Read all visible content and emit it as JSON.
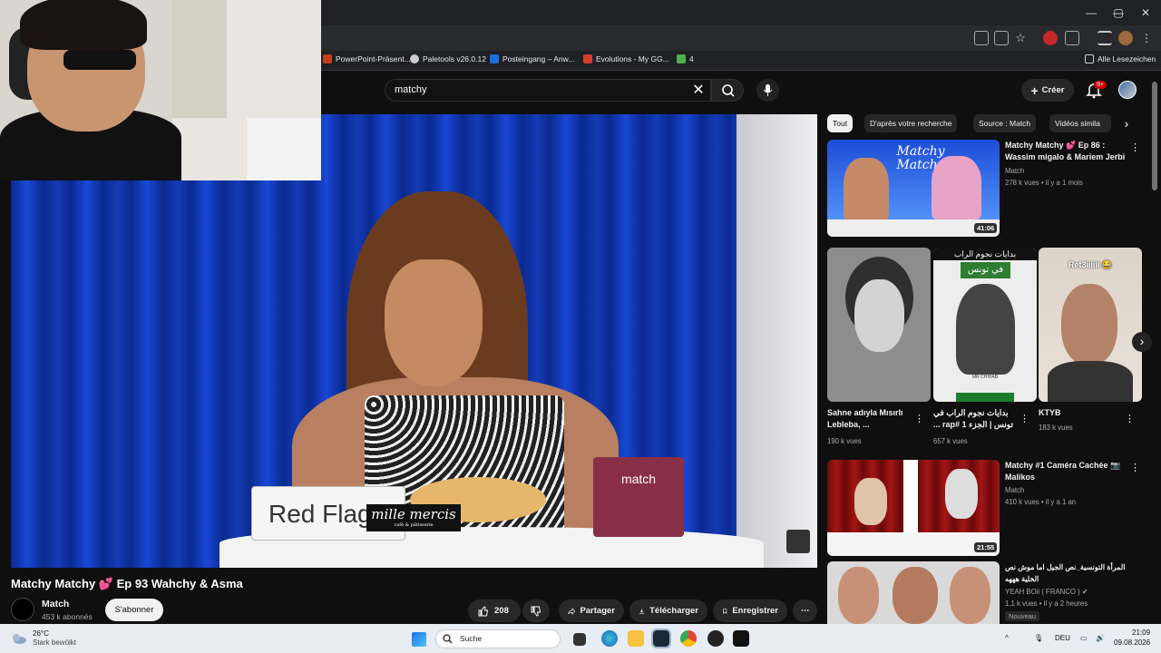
{
  "browser": {
    "window_controls": [
      "—",
      "▢",
      "✕"
    ],
    "bookmarks": [
      {
        "label": "PowerPoint-Präsent...",
        "color": "#c43e1c"
      },
      {
        "label": "Paletools v26.0.12",
        "color": "#cccccc"
      },
      {
        "label": "Posteingang – Anw...",
        "color": "#1e6fd9"
      },
      {
        "label": "Evolutions - My GG...",
        "color": "#d63d2e"
      },
      {
        "label": "4",
        "color": "#4caf50"
      }
    ],
    "all_bookmarks_label": "Alle Lesezeichen"
  },
  "youtube": {
    "search": {
      "query": "matchy"
    },
    "create_label": "Créer",
    "notifications_badge": "9+"
  },
  "video": {
    "title": "Matchy Matchy 💕 Ep 93 Wahchy & Asma",
    "channel": "Match",
    "subscribers": "453 k abonnés",
    "subscribe_label": "S'abonner",
    "likes": "208",
    "share_label": "Partager",
    "download_label": "Télécharger",
    "save_label": "Enregistrer",
    "overlay": {
      "card_text": "Red Flag",
      "sponsor_text": "mille mercis",
      "sponsor_sub": "café & pâtisserie",
      "box_text": "match"
    }
  },
  "chips": [
    "Tout",
    "D'après votre recherche",
    "Source : Match",
    "Vidéos simila"
  ],
  "recommendations": [
    {
      "title": "Matchy Matchy 💕 Ep 86 : Wassim migalo & Mariem Jerbi",
      "channel": "Match",
      "meta": "278 k vues • il y a 1 mois",
      "duration": "41:06",
      "thumb_text": "Matchy Matchy"
    },
    {
      "title": "Matchy #1 Caméra Cachée 📷 Malikos",
      "channel": "Match",
      "meta": "410 k vues • il y a 1 an",
      "duration": "21:55"
    },
    {
      "title": "المرأة التونسية_نص الجيل اما موش نص الخلية هههه",
      "channel": "YEAH BOii ( FRANCO )",
      "meta": "1,1 k vues • il y a 2 heures",
      "badge": "Nouveau"
    }
  ],
  "shorts": [
    {
      "title": "Sahne adıyla Mısırlı Lebleba, ...",
      "views": "190 k vues"
    },
    {
      "title": "بدايات نجوم الراب في تونس | الجزء 1 #rap ...",
      "views": "657 k vues",
      "overlay_top": "بدايات نجوم الراب",
      "overlay_mid": "في تونس",
      "caption": "MR CHIHAB"
    },
    {
      "title": "KTYB",
      "views": "183 k vues",
      "overlay_top": "Ret3iiiiii 😂"
    }
  ],
  "taskbar": {
    "temperature": "26°C",
    "weather": "Stark bewölkt",
    "search_placeholder": "Suche",
    "language": "DEU",
    "time": "21:09",
    "date": "09.08.2026"
  },
  "colors": {
    "background": "#0f0f0f",
    "chip_active": "#f1f1f1",
    "badge": "#cc0000",
    "curtain_blue": "#0b2f9c"
  }
}
